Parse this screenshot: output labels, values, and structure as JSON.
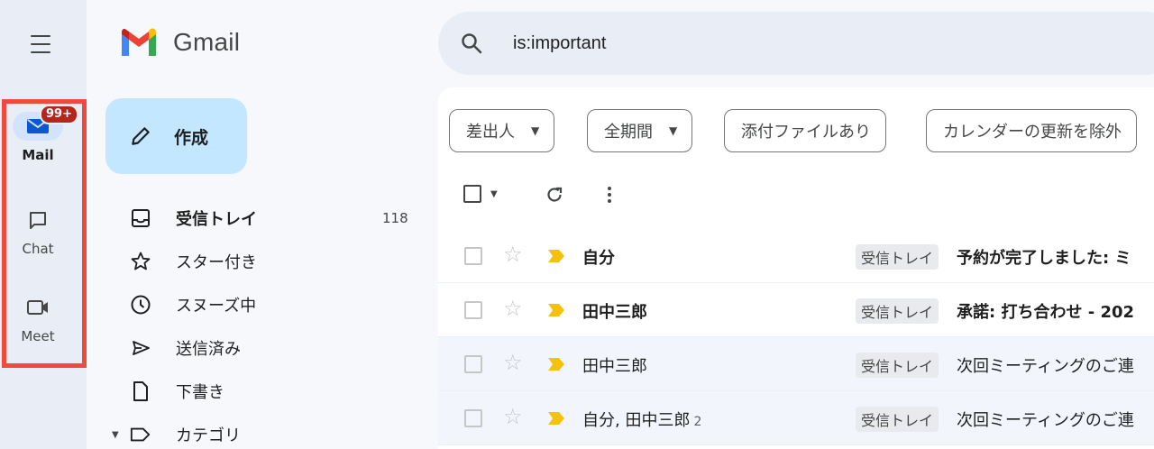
{
  "rail": {
    "items": [
      {
        "label": "Mail",
        "badge": "99+"
      },
      {
        "label": "Chat"
      },
      {
        "label": "Meet"
      }
    ]
  },
  "logo": {
    "text": "Gmail"
  },
  "compose": {
    "label": "作成"
  },
  "nav": [
    {
      "label": "受信トレイ",
      "count": "118",
      "icon": "inbox-icon"
    },
    {
      "label": "スター付き",
      "icon": "star-icon"
    },
    {
      "label": "スヌーズ中",
      "icon": "clock-icon"
    },
    {
      "label": "送信済み",
      "icon": "send-icon"
    },
    {
      "label": "下書き",
      "icon": "draft-icon"
    },
    {
      "label": "カテゴリ",
      "icon": "label-icon"
    }
  ],
  "search": {
    "query": "is:important"
  },
  "filters": [
    {
      "label": "差出人"
    },
    {
      "label": "全期間"
    },
    {
      "label": "添付ファイルあり"
    },
    {
      "label": "カレンダーの更新を除外"
    }
  ],
  "emails": [
    {
      "sender": "自分",
      "count": "",
      "label": "受信トレイ",
      "subject": "予約が完了しました: ミ",
      "unread": true
    },
    {
      "sender": "田中三郎",
      "count": "",
      "label": "受信トレイ",
      "subject": "承諾: 打ち合わせ - 202",
      "unread": true
    },
    {
      "sender": "田中三郎",
      "count": "",
      "label": "受信トレイ",
      "subject": "次回ミーティングのご連",
      "unread": false
    },
    {
      "sender": "自分, 田中三郎",
      "count": "2",
      "label": "受信トレイ",
      "subject": "次回ミーティングのご連",
      "unread": false
    }
  ],
  "colors": {
    "rail_bg": "#e9eef6",
    "highlight_frame": "#f04a3e",
    "compose_bg": "#c2e7ff",
    "badge": "#b3261e",
    "important_marker": "#f4c20d"
  }
}
